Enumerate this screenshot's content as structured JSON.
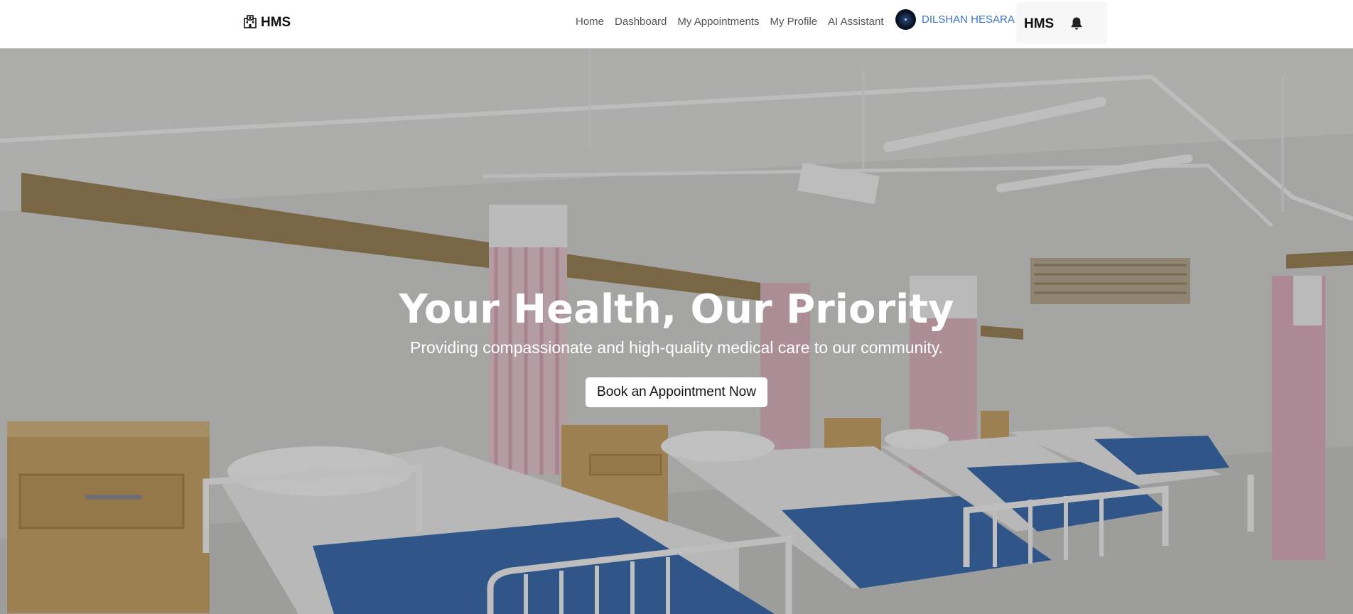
{
  "navbar": {
    "brand": {
      "icon": "hospital-icon",
      "text": "HMS"
    },
    "links": [
      {
        "label": "Home"
      },
      {
        "label": "Dashboard"
      },
      {
        "label": "My Appointments"
      },
      {
        "label": "My Profile"
      },
      {
        "label": "AI Assistant"
      }
    ],
    "user": {
      "name": "DILSHAN HESARA",
      "avatar": "avatar-image",
      "dropdown_icon": "caret-down-icon"
    },
    "right_box": {
      "title": "HMS",
      "notification_icon": "bell-icon"
    }
  },
  "hero": {
    "title": "Your Health, Our Priority",
    "subtitle": "Providing compassionate and high-quality medical care to our community.",
    "cta_label": "Book an Appointment Now"
  },
  "colors": {
    "navbar_bg": "#ffffff",
    "user_link": "#3b73c9",
    "hero_text": "#ffffff",
    "button_bg": "#ffffff",
    "bed_blanket": "#3e6fb0",
    "curtain": "#d9a3b4"
  }
}
